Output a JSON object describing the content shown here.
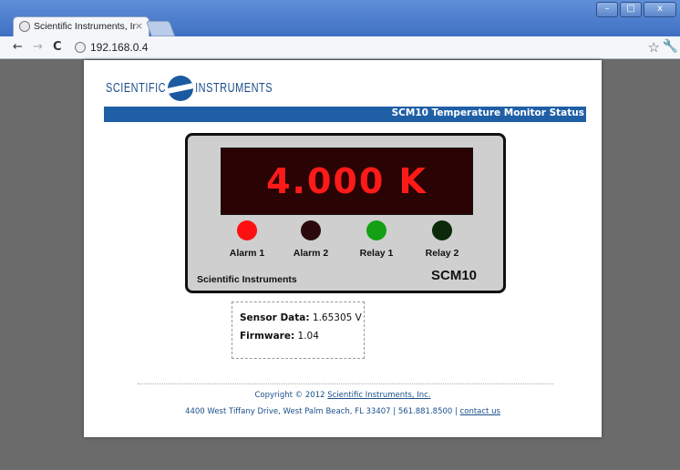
{
  "browser": {
    "tab_title": "Scientific Instruments, Inc. SC",
    "tab_close": "×",
    "url": "192.168.0.4",
    "nav_back": "←",
    "nav_forward": "→",
    "nav_reload": "C",
    "bookmark_star": "☆",
    "wrench_glyph": "🔧",
    "window_buttons": {
      "minimize": "–",
      "maximize": "□",
      "close": "x"
    }
  },
  "header": {
    "logo_left": "SCIENTIFIC",
    "logo_right": "INSTRUMENTS",
    "banner_title": "SCM10 Temperature Monitor Status"
  },
  "instrument": {
    "display_value": "4.000 K",
    "indicators": [
      {
        "label": "Alarm 1",
        "color": "#ff1010"
      },
      {
        "label": "Alarm 2",
        "color": "#2a0a0a"
      },
      {
        "label": "Relay 1",
        "color": "#14a014"
      },
      {
        "label": "Relay 2",
        "color": "#0a2a0a"
      }
    ],
    "brand": "Scientific Instruments",
    "model": "SCM10"
  },
  "info": {
    "sensor_label": "Sensor Data:",
    "sensor_value": "1.65305 V",
    "firmware_label": "Firmware:",
    "firmware_value": "1.04"
  },
  "footer": {
    "copyright_prefix": "Copyright © 2012",
    "company_link": "Scientific Instruments, Inc.",
    "address": "4400 West Tiffany Drive, West Palm Beach, FL 33407 | 561.881.8500 |",
    "contact_link": "contact us"
  }
}
